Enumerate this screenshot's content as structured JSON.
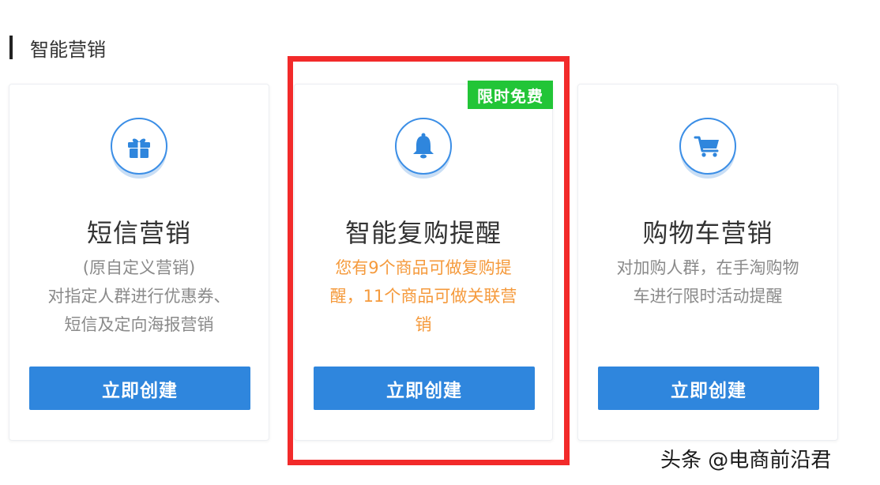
{
  "section": {
    "title": "智能营销"
  },
  "cards": [
    {
      "id": "sms",
      "icon": "gift-icon",
      "title": "短信营销",
      "desc_lines": [
        "(原自定义营销)",
        "对指定人群进行优惠券、",
        "短信及定向海报营销"
      ],
      "button_label": "立即创建"
    },
    {
      "id": "repurchase",
      "icon": "bell-icon",
      "title": "智能复购提醒",
      "badge": "限时免费",
      "desc_lines": [
        "您有9个商品可做复购提",
        "醒，11个商品可做关联营",
        "销"
      ],
      "button_label": "立即创建"
    },
    {
      "id": "cart",
      "icon": "shopping-cart-icon",
      "title": "购物车营销",
      "desc_lines": [
        "对加购人群，在手淘购物",
        "车进行限时活动提醒"
      ],
      "button_label": "立即创建"
    }
  ],
  "colors": {
    "primary_blue": "#2f86dd",
    "highlight_red": "#f22a2a",
    "badge_green": "#22c537",
    "alert_orange": "#f59a3c"
  },
  "watermark": {
    "text": "头条 @电商前沿君"
  }
}
